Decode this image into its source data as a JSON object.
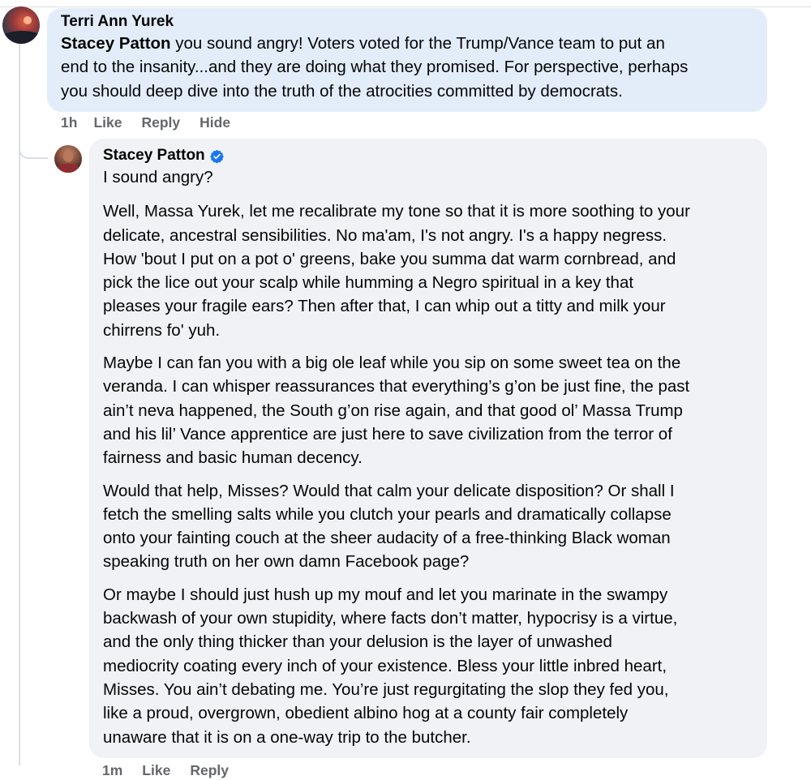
{
  "comment": {
    "author": "Terri Ann Yurek",
    "mention": "Stacey Patton",
    "text_lines": [
      " you sound angry! Voters voted for the Trump/Vance team to put an\nend to the insanity...and they are doing what they promised. For perspective, perhaps\nyou should deep dive into the truth of the atrocities committed by democrats."
    ],
    "time": "1h",
    "like_label": "Like",
    "reply_label": "Reply",
    "hide_label": "Hide"
  },
  "reply": {
    "author": "Stacey Patton",
    "paragraphs": [
      "I sound angry?",
      "Well, Massa Yurek, let me recalibrate my tone so that it is more soothing to your\ndelicate, ancestral sensibilities. No ma'am, I's not angry. I's a happy negress.\nHow 'bout I put on a pot o' greens, bake you summa dat warm cornbread, and\npick the lice out your scalp while humming a Negro spiritual in a key that\npleases your fragile ears? Then after that, I can whip out a titty and milk your\nchirrens fo' yuh.",
      "Maybe I can fan you with a big ole leaf while you sip on some sweet tea on the\nveranda. I can whisper reassurances that everything’s g’on be just fine, the past\nain’t neva happened, the South g’on rise again, and that good ol’ Massa Trump\nand his lil’ Vance apprentice are just here to save civilization from the terror of\nfairness and basic human decency.",
      "Would that help, Misses? Would that calm your delicate disposition? Or shall I\nfetch the smelling salts while you clutch your pearls and dramatically collapse\nonto your fainting couch at the sheer audacity of a free-thinking Black woman\nspeaking truth on her own damn Facebook page?",
      "Or maybe I should just hush up my mouf and let you marinate in the swampy\nbackwash of your own stupidity, where facts don’t matter, hypocrisy is a virtue,\nand the only thing thicker than your delusion is the layer of unwashed\nmediocrity coating every inch of your existence. Bless your little inbred heart,\nMisses. You ain’t debating me. You’re just regurgitating the slop they fed you,\nlike a proud, overgrown, obedient albino hog at a county fair completely\nunaware that it is on a one-way trip to the butcher."
    ],
    "time": "1m",
    "like_label": "Like",
    "reply_label": "Reply"
  },
  "colors": {
    "comment_bubble": "#e3edf9",
    "reply_bubble": "#f0f2f5",
    "verified_badge": "#1877f2",
    "meta_text": "#65676b"
  },
  "icons": {
    "verified": "verified-badge-icon"
  }
}
